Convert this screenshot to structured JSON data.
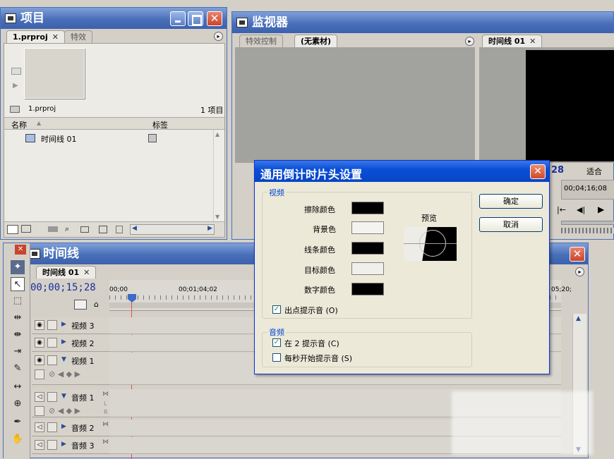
{
  "project": {
    "title": "项目",
    "tabs": [
      "1.prproj",
      "特效"
    ],
    "file_name": "1.prproj",
    "item_count": "1 项目",
    "columns": [
      "名称",
      "标签"
    ],
    "items": [
      {
        "name": "时间线 01"
      }
    ]
  },
  "monitor": {
    "title": "监视器",
    "source_tabs": [
      "特效控制",
      "(无素材)"
    ],
    "program_tab": "时间线 01",
    "program_timecode_partial": "28",
    "fit_label": "适合",
    "end_timecode": "00;04;16;08"
  },
  "timeline": {
    "title": "时间线",
    "tab": "时间线 01",
    "timecode": "00;00;15;28",
    "ruler_labels": [
      "00;00",
      "00;01;04;02",
      "05;20;"
    ],
    "tracks": [
      {
        "name": "视频 3",
        "kind": "video"
      },
      {
        "name": "视频 2",
        "kind": "video"
      },
      {
        "name": "视频 1",
        "kind": "video"
      },
      {
        "name": "音频 1",
        "kind": "audio"
      },
      {
        "name": "音频 2",
        "kind": "audio"
      },
      {
        "name": "音频 3",
        "kind": "audio"
      }
    ],
    "lr_labels": [
      "L",
      "R"
    ]
  },
  "dialog": {
    "title": "通用倒计时片头设置",
    "video_group": "视频",
    "color_labels": [
      "擦除颜色",
      "背景色",
      "线条颜色",
      "目标颜色",
      "数字颜色"
    ],
    "color_values": [
      "#000000",
      "#f4f3ef",
      "#000000",
      "#f0efeb",
      "#000000"
    ],
    "preview_label": "预览",
    "cue_out": "出点提示音 (O)",
    "audio_group": "音频",
    "cue_at_2": "在 2 提示音 (C)",
    "cue_every_second": "每秒开始提示音 (S)",
    "ok": "确定",
    "cancel": "取消",
    "checks": {
      "cue_out": true,
      "cue_at_2": true,
      "cue_every_second": false
    }
  },
  "colors": {
    "title_bar": "#4a6fb9",
    "playhead": "#e0504a",
    "timecode": "#1b2f9b"
  }
}
